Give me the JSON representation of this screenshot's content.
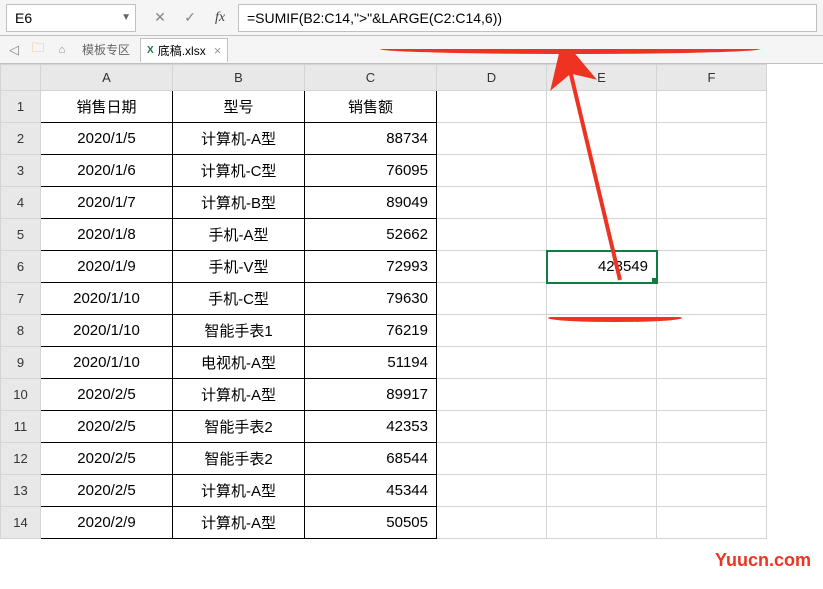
{
  "nameBox": "E6",
  "formula": "=SUMIF(B2:C14,\">\"&LARGE(C2:C14,6))",
  "docTabs": {
    "templateZone": "模板专区",
    "file": "底稿.xlsx"
  },
  "columns": [
    "A",
    "B",
    "C",
    "D",
    "E",
    "F"
  ],
  "headers": {
    "A": "销售日期",
    "B": "型号",
    "C": "销售额"
  },
  "rows": [
    {
      "n": "1"
    },
    {
      "n": "2",
      "A": "2020/1/5",
      "B": "计算机-A型",
      "C": "88734"
    },
    {
      "n": "3",
      "A": "2020/1/6",
      "B": "计算机-C型",
      "C": "76095"
    },
    {
      "n": "4",
      "A": "2020/1/7",
      "B": "计算机-B型",
      "C": "89049"
    },
    {
      "n": "5",
      "A": "2020/1/8",
      "B": "手机-A型",
      "C": "52662"
    },
    {
      "n": "6",
      "A": "2020/1/9",
      "B": "手机-V型",
      "C": "72993",
      "E": "423549"
    },
    {
      "n": "7",
      "A": "2020/1/10",
      "B": "手机-C型",
      "C": "79630"
    },
    {
      "n": "8",
      "A": "2020/1/10",
      "B": "智能手表1",
      "C": "76219"
    },
    {
      "n": "9",
      "A": "2020/1/10",
      "B": "电视机-A型",
      "C": "51194"
    },
    {
      "n": "10",
      "A": "2020/2/5",
      "B": "计算机-A型",
      "C": "89917"
    },
    {
      "n": "11",
      "A": "2020/2/5",
      "B": "智能手表2",
      "C": "42353"
    },
    {
      "n": "12",
      "A": "2020/2/5",
      "B": "智能手表2",
      "C": "68544"
    },
    {
      "n": "13",
      "A": "2020/2/5",
      "B": "计算机-A型",
      "C": "45344"
    },
    {
      "n": "14",
      "A": "2020/2/9",
      "B": "计算机-A型",
      "C": "50505"
    }
  ],
  "watermark": "Yuucn.com"
}
